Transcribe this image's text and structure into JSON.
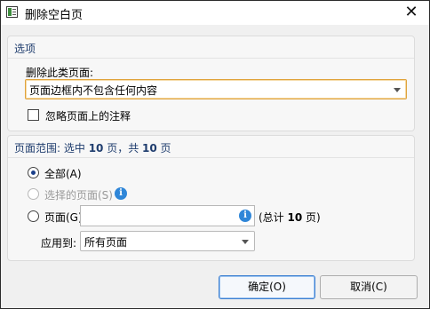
{
  "window": {
    "title": "删除空白页",
    "close_glyph": "✕"
  },
  "section_options": {
    "title": "选项",
    "delete_label": "删除此类页面:",
    "delete_type_selected": "页面边框内不包含任何内容",
    "ignore_annotations_label": "忽略页面上的注释",
    "ignore_annotations_checked": false
  },
  "section_range": {
    "title_prefix": "页面范围: 选中 ",
    "selected_count": "10",
    "title_mid": " 页，共 ",
    "total_count": "10",
    "title_suffix": " 页",
    "radio_all": "全部(A)",
    "radio_selected": "选择的页面(S)",
    "radio_pages": "页面(G)",
    "pages_input_value": "",
    "total_prefix": "(总计 ",
    "total_pages": "10",
    "total_suffix": " 页)",
    "apply_label": "应用到:",
    "apply_selected": "所有页面",
    "selected_radio": "all"
  },
  "buttons": {
    "ok": "确定(O)",
    "cancel": "取消(C)"
  },
  "colors": {
    "accent": "#1a3f8a",
    "section_title": "#1f3d6e",
    "info": "#2f86d8",
    "focus_border": "#e0a33c"
  },
  "icons": {
    "info": "info-icon",
    "app": "app-icon",
    "close": "close-icon"
  }
}
